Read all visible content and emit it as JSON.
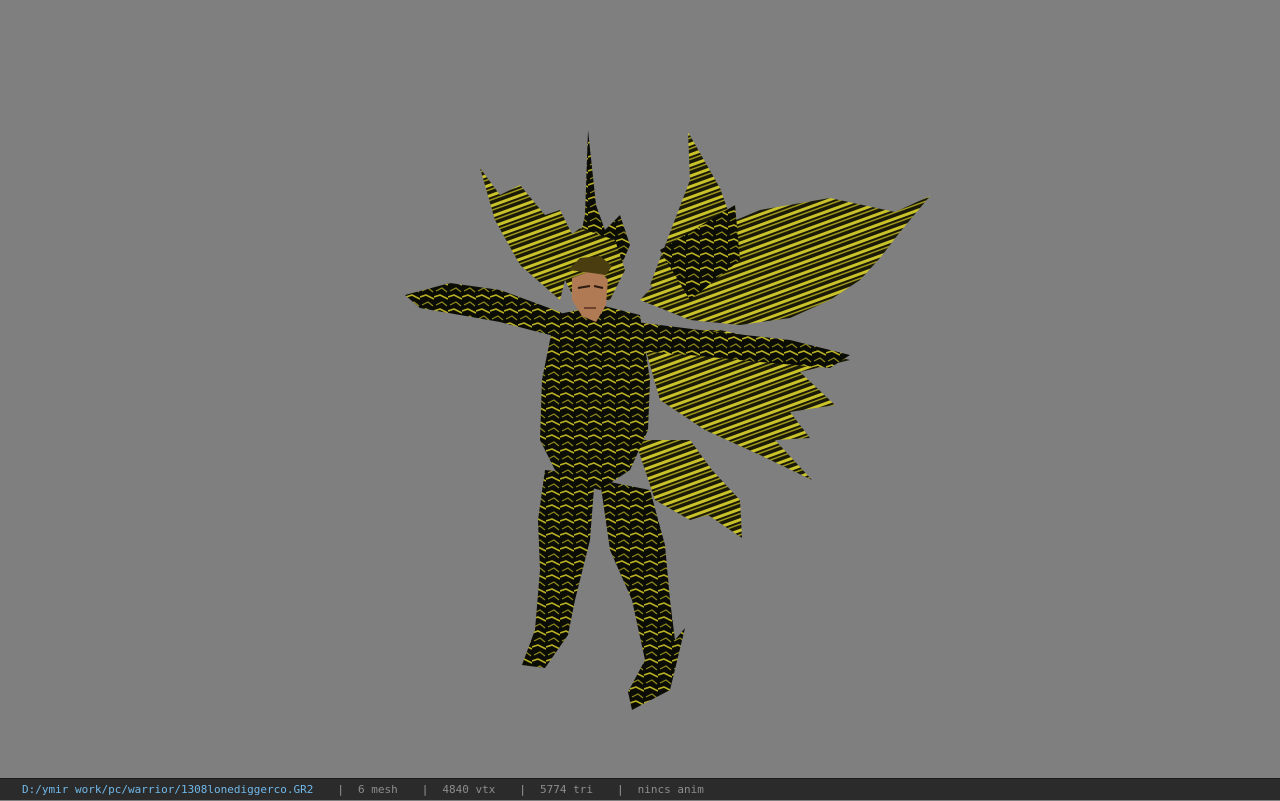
{
  "viewer": {
    "background_color": "#7f7f7f",
    "model_name": "warrior",
    "model_colors": {
      "armor_dark": "#0b0c04",
      "armor_gold": "#c8c22a",
      "skin": "#b07a55"
    }
  },
  "status": {
    "file_path": "D:/ymir work/pc/warrior/1308lonediggerco.GR2",
    "separator": "|",
    "mesh": "6 mesh",
    "vertices": "4840 vtx",
    "triangles": "5774 tri",
    "anim": "nincs anim",
    "path_color": "#6fb7e8"
  }
}
